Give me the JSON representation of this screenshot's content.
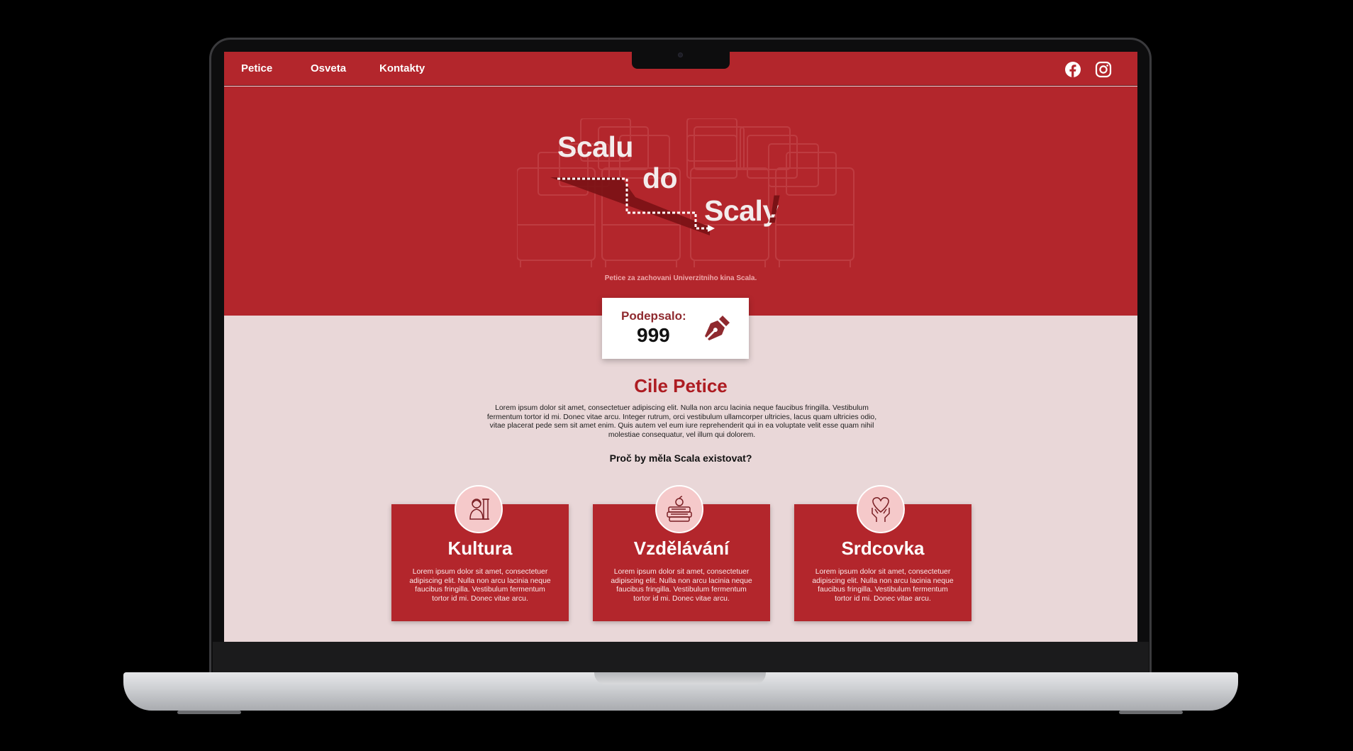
{
  "nav": {
    "links": [
      "Petice",
      "Osveta",
      "Kontakty"
    ],
    "social": [
      "facebook-icon",
      "instagram-icon"
    ]
  },
  "hero": {
    "logo_words": [
      "Scalu",
      "do",
      "Scaly",
      "!"
    ],
    "subtitle": "Petice za zachovani Univerzitniho kina Scala."
  },
  "signature": {
    "label": "Podepsalo:",
    "count": "999",
    "icon": "pen-nib-icon"
  },
  "goals": {
    "title": "Cile Petice",
    "text": "Lorem ipsum dolor sit amet, consectetuer adipiscing elit. Nulla non arcu lacinia neque faucibus fringilla. Vestibulum fermentum tortor id mi. Donec vitae arcu. Integer rutrum, orci vestibulum ullamcorper ultricies, lacus quam ultricies odio, vitae placerat pede sem sit amet enim. Quis autem vel eum iure reprehenderit qui in ea voluptate velit esse quam nihil molestiae consequatur, vel illum qui dolorem.",
    "question": "Proč by měla Scala existovat?"
  },
  "cards": [
    {
      "title": "Kultura",
      "icon": "bust-statue-icon",
      "text": "Lorem ipsum dolor sit amet, consectetuer adipiscing elit. Nulla non arcu lacinia neque faucibus fringilla. Vestibulum fermentum tortor id mi. Donec vitae arcu."
    },
    {
      "title": "Vzdělávání",
      "icon": "books-apple-icon",
      "text": "Lorem ipsum dolor sit amet, consectetuer adipiscing elit. Nulla non arcu lacinia neque faucibus fringilla. Vestibulum fermentum tortor id mi. Donec vitae arcu."
    },
    {
      "title": "Srdcovka",
      "icon": "heart-hands-icon",
      "text": "Lorem ipsum dolor sit amet, consectetuer adipiscing elit. Nulla non arcu lacinia neque faucibus fringilla. Vestibulum fermentum tortor id mi. Donec vitae arcu."
    }
  ],
  "colors": {
    "brand_red": "#b3262c",
    "page_bg": "#e9d7d8",
    "title_red": "#ad1c22"
  }
}
